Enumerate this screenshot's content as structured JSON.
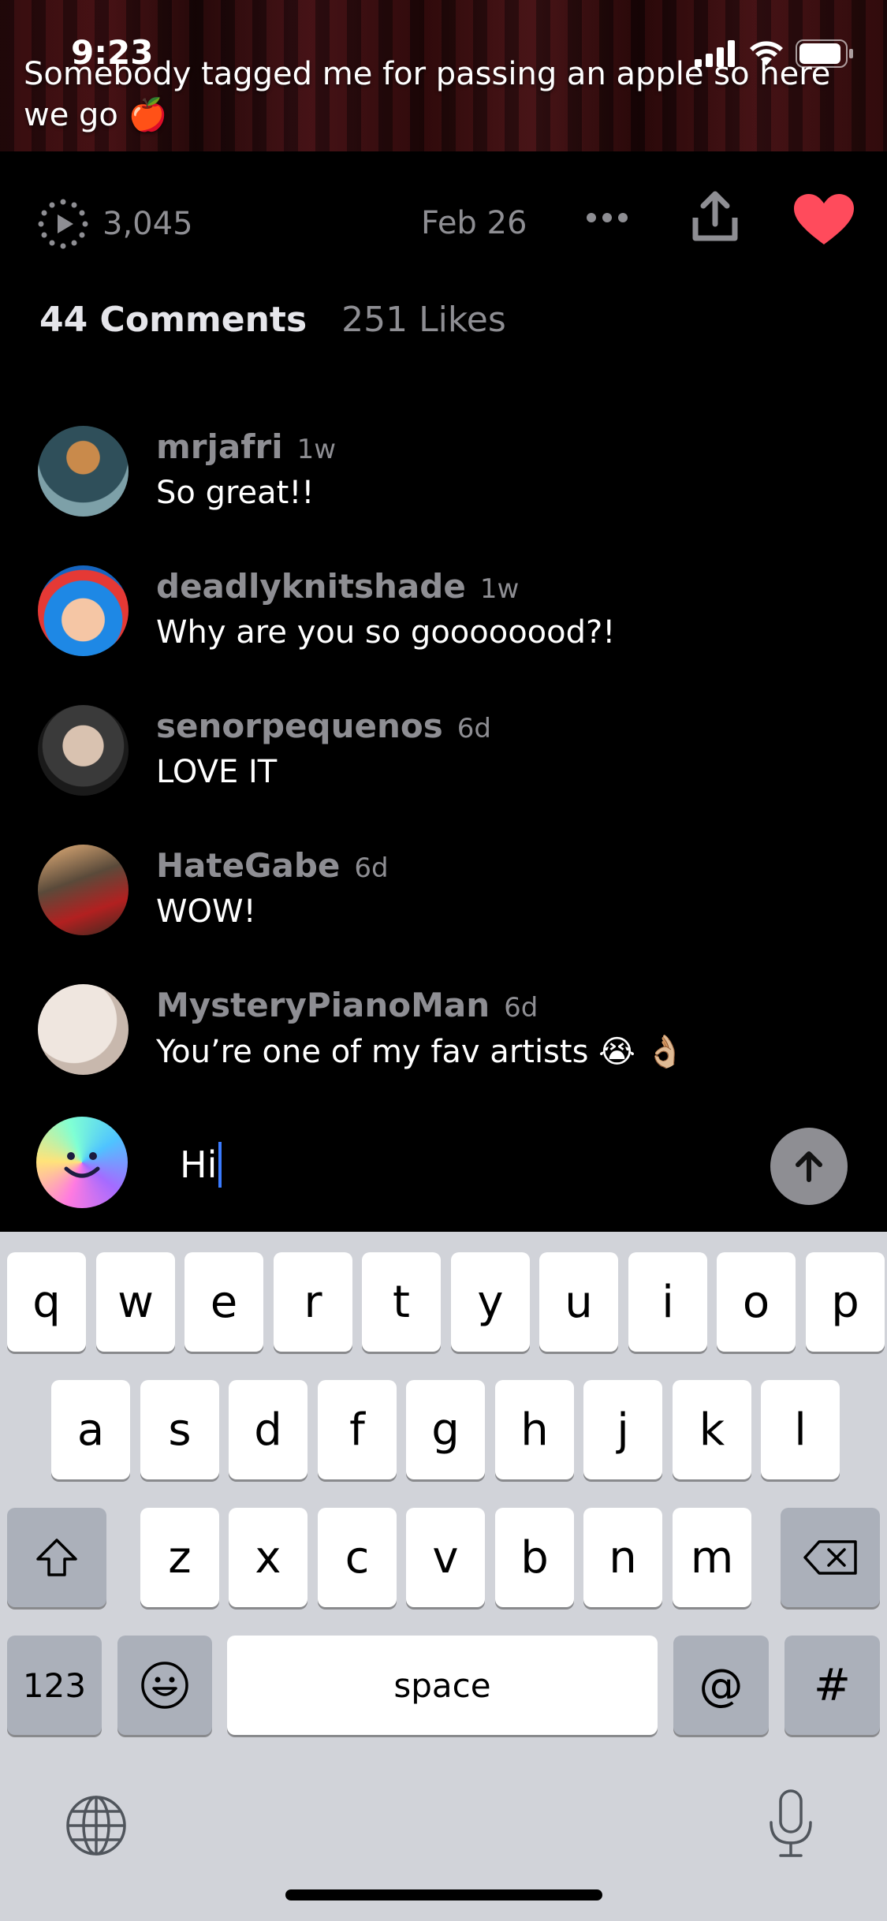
{
  "status_bar": {
    "time": "9:23"
  },
  "post": {
    "caption": "Somebody tagged me for passing an apple so here we go 🍎",
    "plays": "3,045",
    "date": "Feb 26"
  },
  "tabs": {
    "comments": "44 Comments",
    "likes": "251 Likes"
  },
  "comments": [
    {
      "user": "mrjafri",
      "time": "1w",
      "text": "So great!!",
      "avatar_colors": [
        "#2f4f5a",
        "#c98a4b",
        "#7da0a8"
      ]
    },
    {
      "user": "deadlyknitshade",
      "time": "1w",
      "text": "Why are you so goooooood?!",
      "avatar_colors": [
        "#1e88e5",
        "#e53935",
        "#f5c6a5"
      ]
    },
    {
      "user": "senorpequenos",
      "time": "6d",
      "text": "LOVE IT",
      "avatar_colors": [
        "#3a3a3a",
        "#d9c2b0",
        "#1a1a1a"
      ]
    },
    {
      "user": "HateGabe",
      "time": "6d",
      "text": "WOW!",
      "avatar_colors": [
        "#b22020",
        "#e8b27a",
        "#5a4a3a"
      ]
    },
    {
      "user": "MysteryPianoMan",
      "time": "6d",
      "text": "You’re one of my fav artists 😭 👌🏼",
      "avatar_colors": [
        "#efe6df",
        "#9b3a3a",
        "#6a6a6a"
      ]
    }
  ],
  "composer": {
    "value": "Hi"
  },
  "keyboard": {
    "row1": [
      "q",
      "w",
      "e",
      "r",
      "t",
      "y",
      "u",
      "i",
      "o",
      "p"
    ],
    "row2": [
      "a",
      "s",
      "d",
      "f",
      "g",
      "h",
      "j",
      "k",
      "l"
    ],
    "row3": [
      "z",
      "x",
      "c",
      "v",
      "b",
      "n",
      "m"
    ],
    "numbers_label": "123",
    "space_label": "space",
    "at_label": "@",
    "hash_label": "#"
  },
  "colors": {
    "heart": "#ff4b5c",
    "caret": "#3a7bff",
    "send_button": "#8e8e93",
    "keyboard_bg": "#d1d3d9"
  }
}
